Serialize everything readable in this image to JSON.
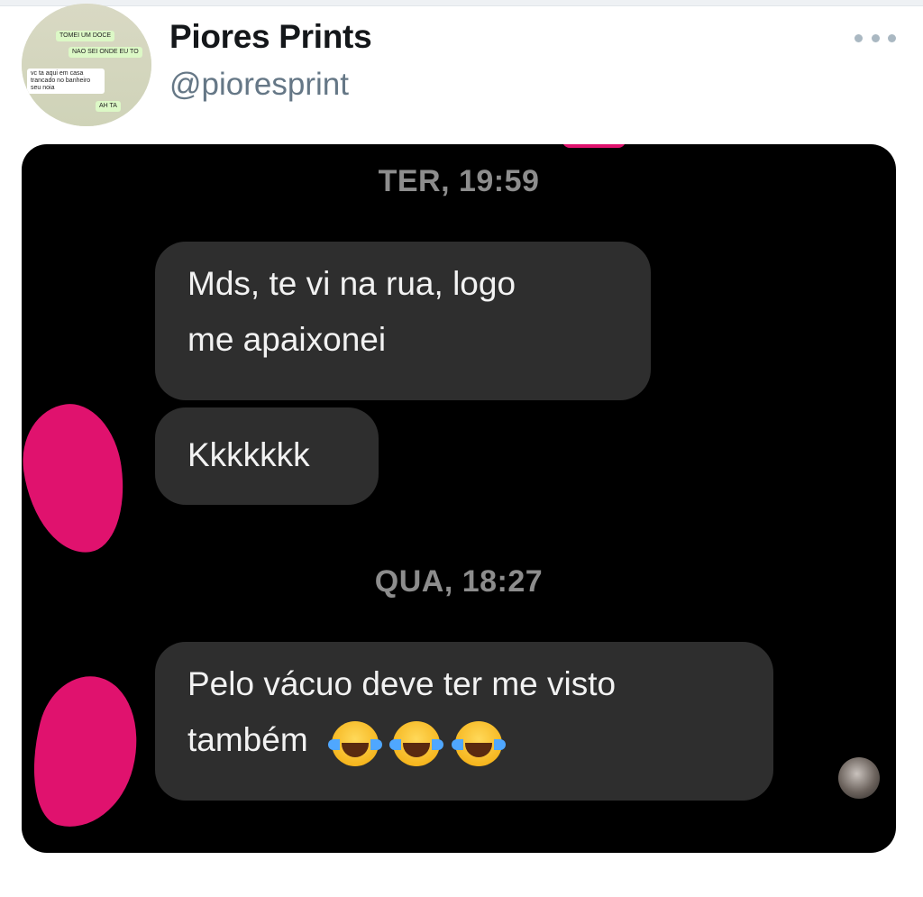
{
  "tweet": {
    "display_name": "Piores Prints",
    "handle": "@pioresprint",
    "more_icon": "more-horizontal-icon",
    "avatar_thumbnail": {
      "messages": [
        {
          "text": "TOMEI UM DOCE",
          "direction": "out"
        },
        {
          "text": "NAO SEI ONDE EU TO",
          "direction": "out"
        },
        {
          "text": "vc ta aqui em casa trancado no banheiro seu noia",
          "direction": "in"
        },
        {
          "text": "AH TA",
          "direction": "out"
        }
      ]
    }
  },
  "chat": {
    "colors": {
      "background": "#000000",
      "bubble": "#2e2e2e",
      "redaction": "#e0126e"
    },
    "timestamps": [
      "TER, 19:59",
      "QUA, 18:27"
    ],
    "messages": [
      {
        "line1": "Mds, te vi na rua, logo",
        "line2": "me apaixonei"
      },
      {
        "line1": "Kkkkkkk"
      },
      {
        "line1": "Pelo vácuo deve ter me visto",
        "line2": "também",
        "emojis": [
          "face-with-tears-of-joy",
          "face-with-tears-of-joy",
          "face-with-tears-of-joy"
        ]
      }
    ]
  }
}
